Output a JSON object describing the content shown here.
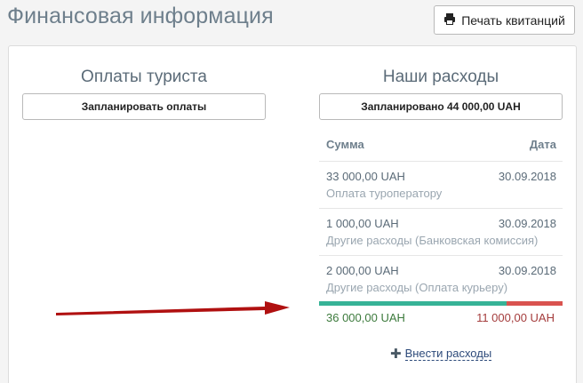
{
  "header": {
    "title": "Финансовая информация",
    "print_label": "Печать квитанций"
  },
  "tourist_payments": {
    "title": "Оплаты туриста",
    "plan_button": "Запланировать оплаты"
  },
  "expenses": {
    "title": "Наши расходы",
    "planned_button": "Запланировано 44 000,00 UAH",
    "columns": {
      "sum": "Сумма",
      "date": "Дата"
    },
    "rows": [
      {
        "amount": "33 000,00 UAH",
        "date": "30.09.2018",
        "description": "Оплата туроператору"
      },
      {
        "amount": "1 000,00 UAH",
        "date": "30.09.2018",
        "description": "Другие расходы (Банковская комиссия)"
      },
      {
        "amount": "2 000,00 UAH",
        "date": "30.09.2018",
        "description": "Другие расходы (Оплата курьеру)"
      }
    ],
    "paid_total": "36 000,00 UAH",
    "unpaid_total": "11 000,00 UAH",
    "paid_fraction": 0.77,
    "add_link": "Внести расходы"
  },
  "colors": {
    "paid": "#37b397",
    "unpaid": "#d9534f",
    "arrow": "#b01010"
  }
}
